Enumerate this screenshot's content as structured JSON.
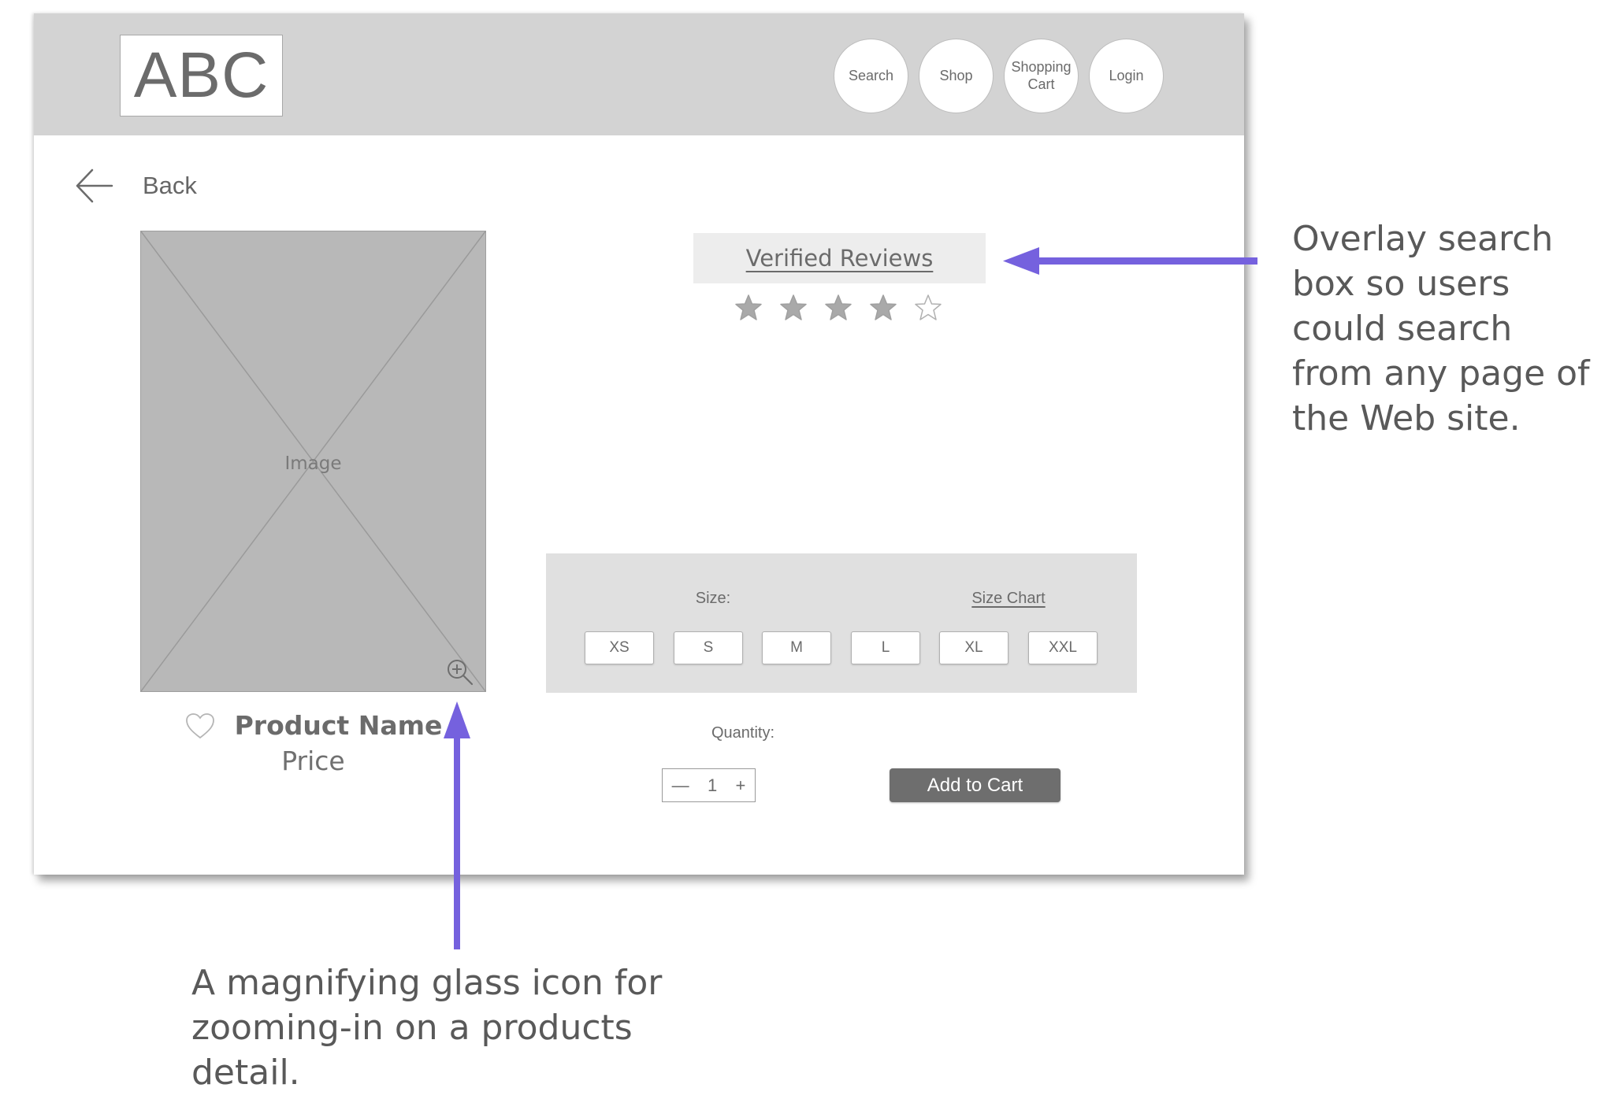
{
  "header": {
    "logo_text": "ABC",
    "nav": [
      {
        "label": "Search",
        "icon": "search"
      },
      {
        "label": "Shop",
        "icon": "shop"
      },
      {
        "label": "Shopping\nCart",
        "icon": "cart"
      },
      {
        "label": "Login",
        "icon": "login"
      }
    ]
  },
  "back": {
    "label": "Back",
    "icon": "arrow-left-icon"
  },
  "product": {
    "image_placeholder": "Image",
    "name": "Product Name",
    "price": "Price",
    "favorite_icon": "heart-outline-icon",
    "zoom_icon": "zoom-in-icon"
  },
  "reviews": {
    "label": "Verified Reviews",
    "rating": 4,
    "max_rating": 5
  },
  "size_selector": {
    "label": "Size:",
    "chart_link": "Size Chart",
    "options": [
      "XS",
      "S",
      "M",
      "L",
      "XL",
      "XXL"
    ]
  },
  "quantity": {
    "label": "Quantity:",
    "value": "1",
    "decrement": "—",
    "increment": "+"
  },
  "actions": {
    "add_to_cart": "Add to Cart"
  },
  "annotations": {
    "search_note": "Overlay search\nbox so users\ncould search\nfrom any page of\nthe Web site.",
    "zoom_note": "A magnifying glass icon for\nzooming-in on a products\ndetail.",
    "arrow_color": "#7561DE"
  },
  "colors": {
    "header_bg": "#D3D3D3",
    "image_placeholder": "#B8B8B8",
    "panel_bg": "#E0E0E0",
    "button_dark": "#6E6E6E",
    "text": "#666666"
  }
}
